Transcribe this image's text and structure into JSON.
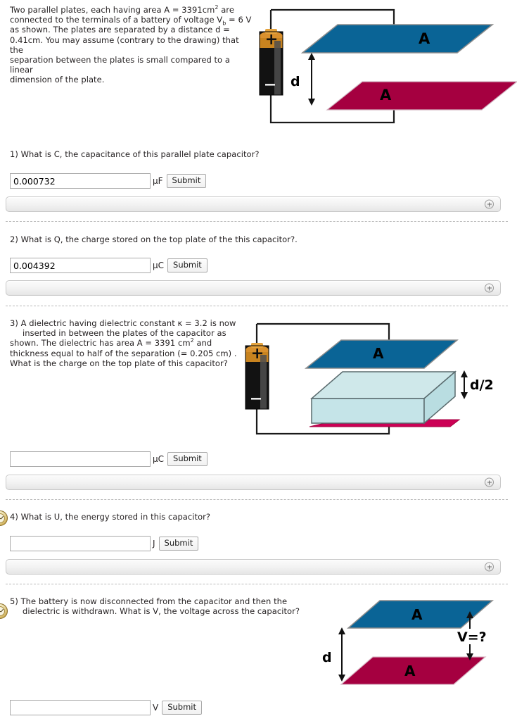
{
  "intro": {
    "line1_a": "Two parallel plates, each having area A = 3391cm",
    "line1_sup": "2",
    "line1_b": " are",
    "line2_a": "connected to the terminals of a battery of voltage V",
    "line2_sub": "b",
    "line2_b": " = 6 V",
    "line3": "as shown. The plates are separated by a distance d =",
    "line4": "0.41cm. You may assume (contrary to the drawing) that the",
    "line5": "separation between the plates is small compared to a linear",
    "line6": "dimension of the plate."
  },
  "questions": [
    {
      "number": "1)",
      "text": "1) What is C, the capacitance of this parallel plate capacitor?",
      "value": "0.000732",
      "placeholder": "",
      "unit": "µF",
      "submit_label": "Submit",
      "has_clock": false
    },
    {
      "number": "2)",
      "text": "2) What is Q, the charge stored on the top plate of the this capacitor?.",
      "value": "0.004392",
      "placeholder": "",
      "unit": "µC",
      "submit_label": "Submit",
      "has_clock": false
    },
    {
      "number": "3)",
      "line1": "3) A dielectric having dielectric constant κ = 3.2 is now",
      "line2": "inserted in between the plates of the capacitor as",
      "line3_a": "shown. The dielectric has area A = 3391 cm",
      "line3_sup": "2",
      "line3_b": " and",
      "line4": "thickness equal to half of the separation (= 0.205 cm) .",
      "line5": "What is the charge on the top plate of this capacitor?",
      "value": "",
      "placeholder": "",
      "unit": "µC",
      "submit_label": "Submit",
      "has_clock": false
    },
    {
      "number": "4)",
      "text": "4) What is U, the energy stored in this capacitor?",
      "value": "",
      "placeholder": "",
      "unit": "J",
      "submit_label": "Submit",
      "has_clock": true
    },
    {
      "number": "5)",
      "line1": "5) The battery is now disconnected from the capacitor and then the",
      "line2": "dielectric is withdrawn. What is V, the voltage across the capacitor?",
      "value": "",
      "placeholder": "",
      "unit": "V",
      "submit_label": "Submit",
      "has_clock": true
    }
  ],
  "diagrams": {
    "diagram1": {
      "top_plate_label": "A",
      "bottom_plate_label": "A",
      "gap_label": "d",
      "battery_plus": "+",
      "battery_minus": "−"
    },
    "diagram2": {
      "top_plate_label": "A",
      "thickness_label": "d/2",
      "battery_plus": "+",
      "battery_minus": "−"
    },
    "diagram3": {
      "top_plate_label": "A",
      "bottom_plate_label": "A",
      "gap_label": "d",
      "voltage_label": "V=?"
    }
  },
  "colors": {
    "top_plate_blue": "#0a6496",
    "bottom_plate_maroon": "#a50040",
    "dielectric_cyan": "#c5e4e8",
    "dielectric_edge": "#5a6b6e",
    "battery_cap": "#d9902d",
    "battery_body": "#121212",
    "wire": "#1a1a1a",
    "status_bar_border": "#c9c9c9"
  }
}
